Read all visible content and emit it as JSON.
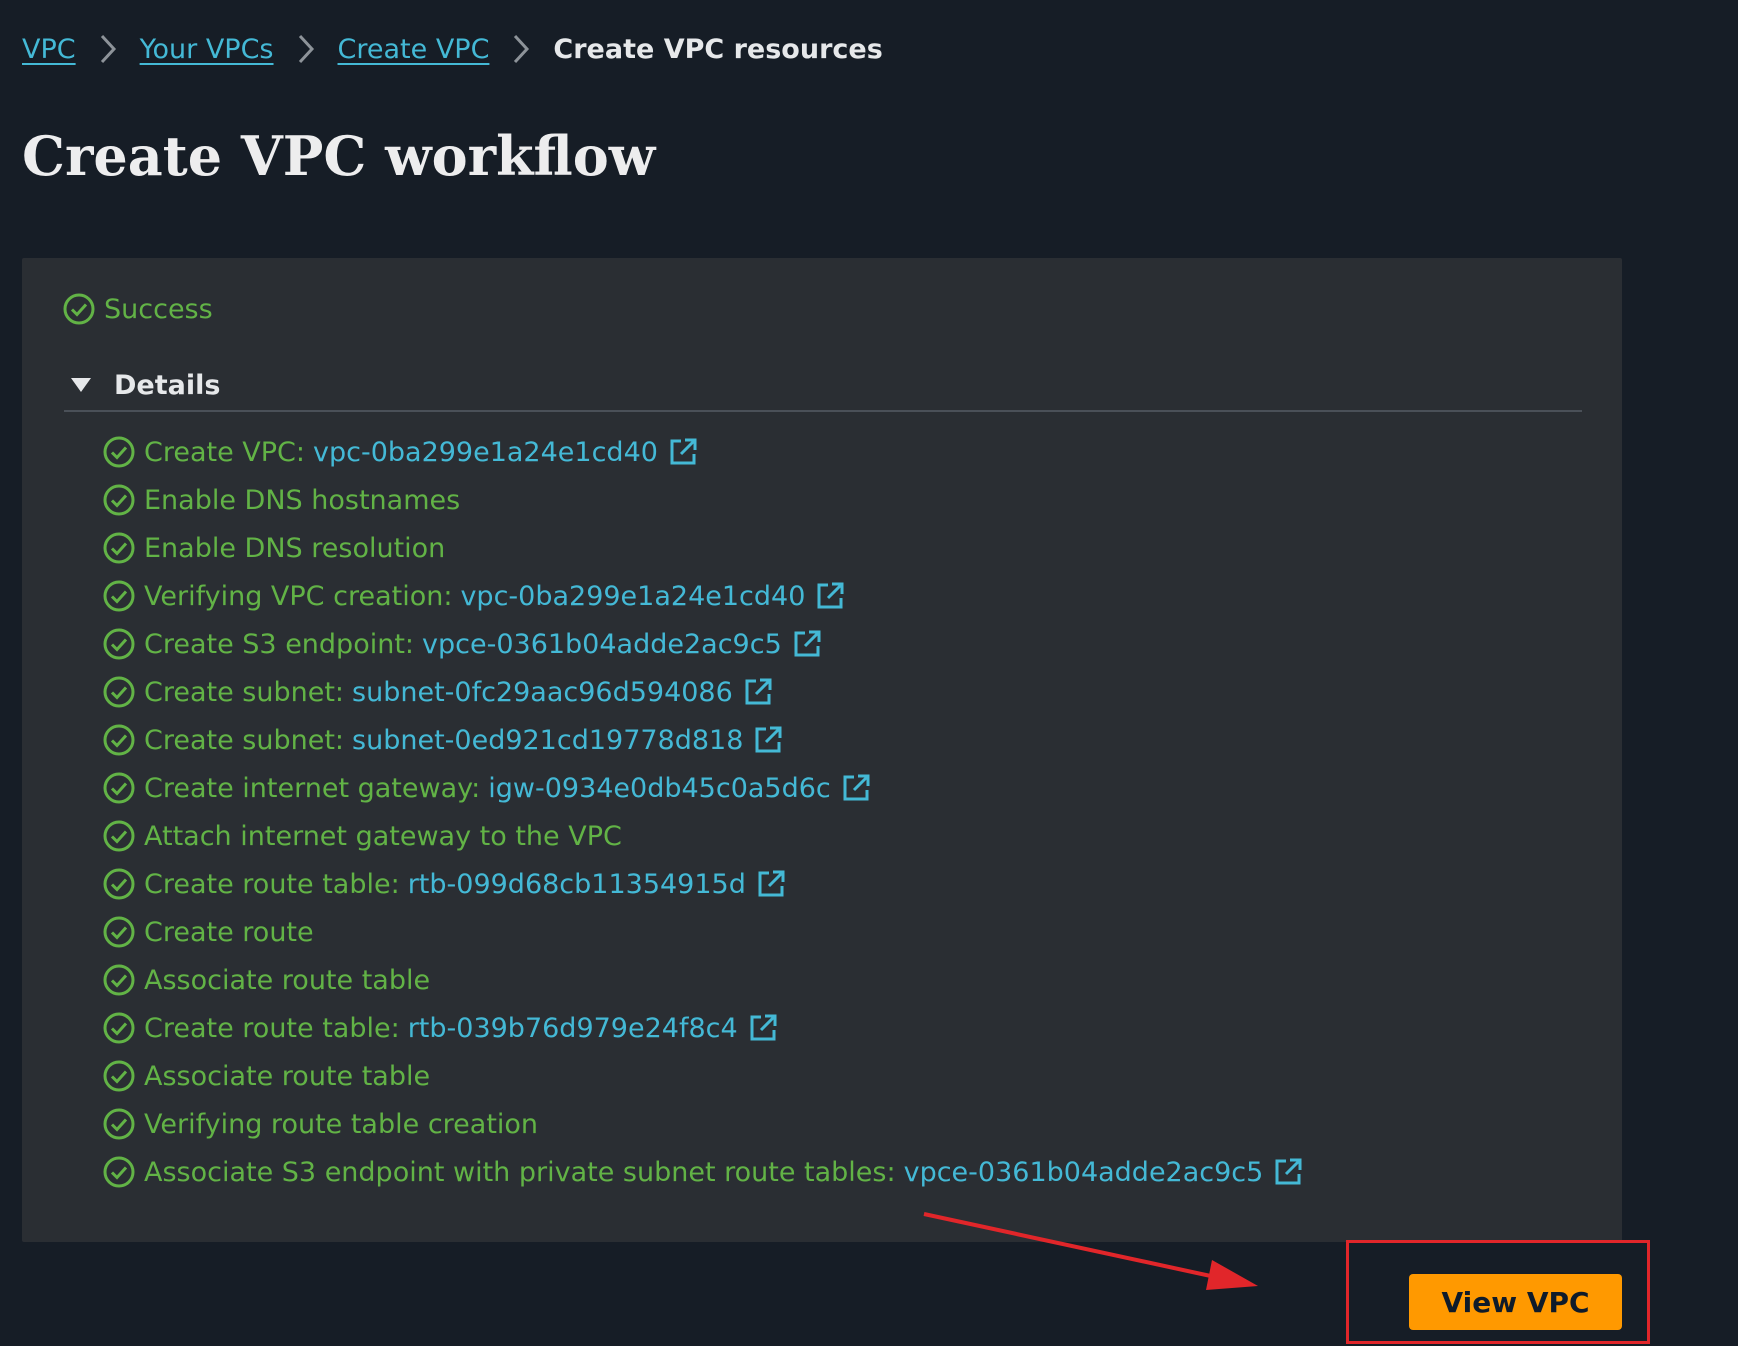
{
  "breadcrumb": {
    "items": [
      "VPC",
      "Your VPCs",
      "Create VPC"
    ],
    "current": "Create VPC resources"
  },
  "page_title": "Create VPC workflow",
  "status": {
    "label": "Success",
    "icon": "check-circle-icon",
    "color": "#62b346"
  },
  "details": {
    "label": "Details",
    "expanded": true,
    "steps": [
      {
        "text": "Create VPC:",
        "link": "vpc-0ba299e1a24e1cd40"
      },
      {
        "text": "Enable DNS hostnames",
        "link": null
      },
      {
        "text": "Enable DNS resolution",
        "link": null
      },
      {
        "text": "Verifying VPC creation:",
        "link": "vpc-0ba299e1a24e1cd40"
      },
      {
        "text": "Create S3 endpoint:",
        "link": "vpce-0361b04adde2ac9c5"
      },
      {
        "text": "Create subnet:",
        "link": "subnet-0fc29aac96d594086"
      },
      {
        "text": "Create subnet:",
        "link": "subnet-0ed921cd19778d818"
      },
      {
        "text": "Create internet gateway:",
        "link": "igw-0934e0db45c0a5d6c"
      },
      {
        "text": "Attach internet gateway to the VPC",
        "link": null
      },
      {
        "text": "Create route table:",
        "link": "rtb-099d68cb11354915d"
      },
      {
        "text": "Create route",
        "link": null
      },
      {
        "text": "Associate route table",
        "link": null
      },
      {
        "text": "Create route table:",
        "link": "rtb-039b76d979e24f8c4"
      },
      {
        "text": "Associate route table",
        "link": null
      },
      {
        "text": "Verifying route table creation",
        "link": null
      },
      {
        "text": "Associate S3 endpoint with private subnet route tables:",
        "link": "vpce-0361b04adde2ac9c5"
      }
    ]
  },
  "actions": {
    "view_vpc_label": "View VPC"
  },
  "colors": {
    "background": "#161d26",
    "panel": "#2a2e33",
    "link": "#44b9d6",
    "success": "#62b346",
    "primary_button": "#ff9900",
    "annotation": "#e1262a"
  }
}
